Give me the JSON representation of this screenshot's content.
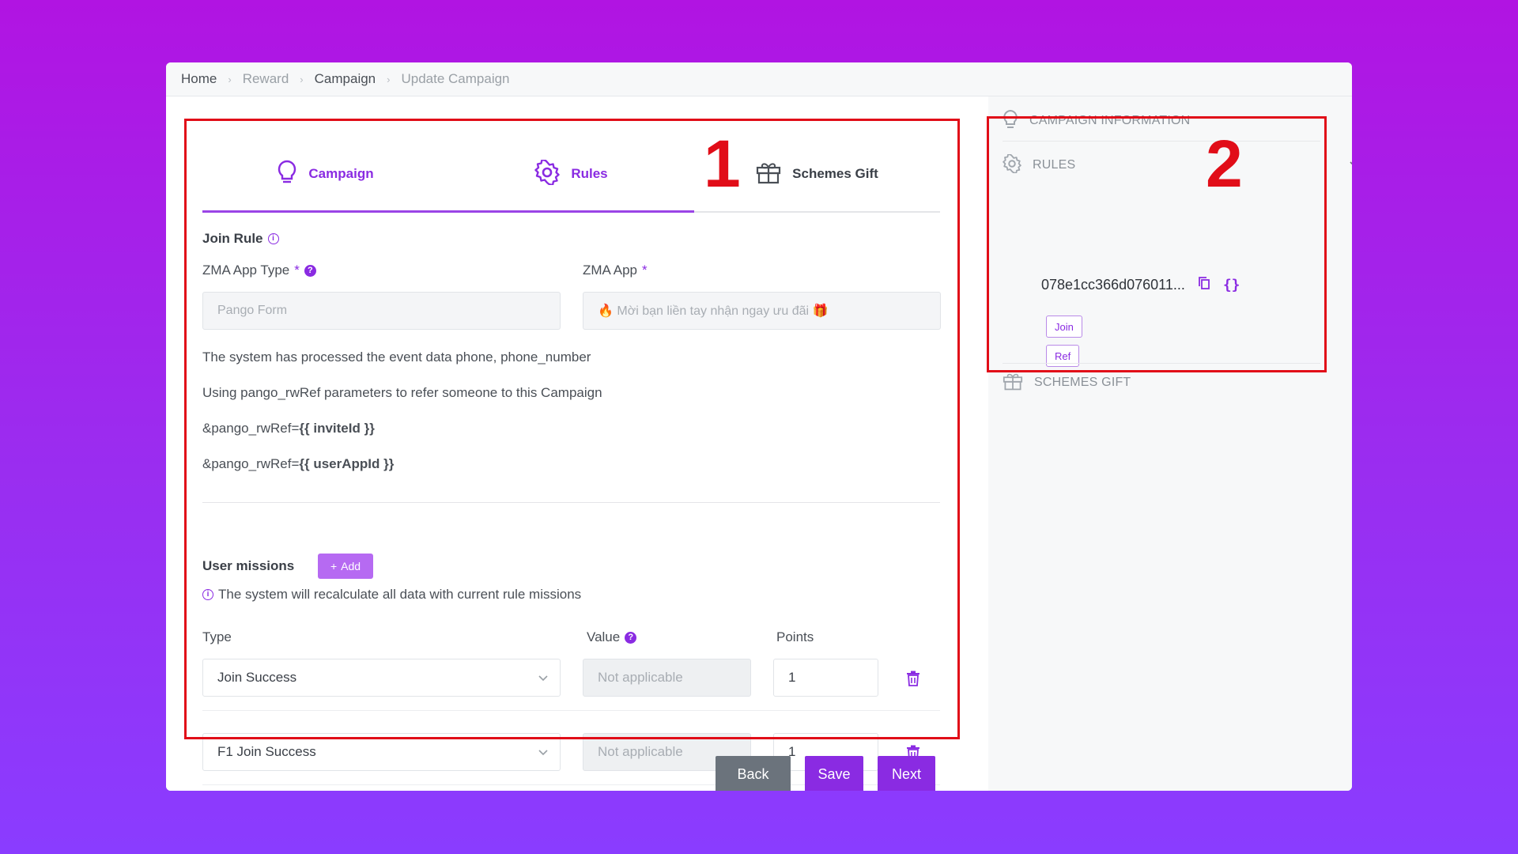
{
  "breadcrumb": {
    "items": [
      "Home",
      "Reward",
      "Campaign",
      "Update Campaign"
    ]
  },
  "tabs": [
    {
      "label": "Campaign",
      "icon": "lightbulb-icon"
    },
    {
      "label": "Rules",
      "icon": "gear-icon"
    },
    {
      "label": "Schemes Gift",
      "icon": "gift-icon"
    }
  ],
  "join_rule": {
    "title": "Join Rule",
    "zma_app_type_label": "ZMA App Type",
    "zma_app_type_value": "Pango Form",
    "zma_app_label": "ZMA App",
    "zma_app_value": "🔥 Mời bạn liền tay nhận ngay ưu đãi 🎁",
    "required_mark": "*"
  },
  "info_text": {
    "line1": "The system has processed the event data phone, phone_number",
    "line2": "Using pango_rwRef parameters to refer someone to this Campaign",
    "ref1_prefix": "&pango_rwRef=",
    "ref1_var": "{{ inviteId }}",
    "ref2_prefix": "&pango_rwRef=",
    "ref2_var": "{{ userAppId }}"
  },
  "missions": {
    "title": "User missions",
    "add_label": "Add",
    "notice": "The system will recalculate all data with current rule missions",
    "col_type": "Type",
    "col_value": "Value",
    "col_points": "Points",
    "rows": [
      {
        "type": "Join Success",
        "value": "Not applicable",
        "points": "1"
      },
      {
        "type": "F1 Join Success",
        "value": "Not applicable",
        "points": "1"
      }
    ]
  },
  "footer_buttons": {
    "back": "Back",
    "save": "Save",
    "next": "Next"
  },
  "right_panel": {
    "campaign_info": "CAMPAIGN INFORMATION",
    "rules": "RULES",
    "rule_id": "078e1cc366d076011...",
    "tags": [
      "Join",
      "Ref"
    ],
    "schemes_gift": "SCHEMES GIFT"
  },
  "annotations": {
    "marker1": "1",
    "marker2": "2"
  },
  "colors": {
    "accent": "#8a2be2",
    "highlight": "#e10d18",
    "background_top": "#b114e2",
    "background_bottom": "#8a3cff"
  }
}
